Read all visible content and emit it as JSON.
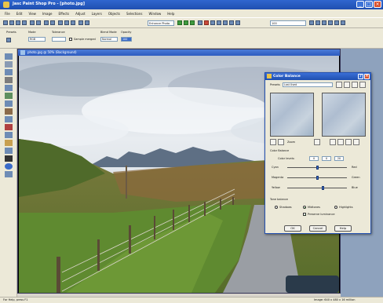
{
  "app": {
    "title": "Jasc Paint Shop Pro - [photo.jpg]",
    "menu": [
      "File",
      "Edit",
      "View",
      "Image",
      "Effects",
      "Adjust",
      "Layers",
      "Objects",
      "Selections",
      "Window",
      "Help"
    ]
  },
  "toolbar": {
    "dropdown_left": "Enhance Photo",
    "dropdown_right": "100"
  },
  "options": {
    "presets_label": "Presets",
    "mode_label": "Mode",
    "mode_value": "RGB",
    "tolerance_label": "Tolerance",
    "sample_label": "Sample merged",
    "blend_label": "Blend Mode",
    "blend_value": "Normal",
    "opacity_label": "Opacity",
    "opacity_value": "100"
  },
  "document": {
    "title": "photo.jpg @ 50% (Background)"
  },
  "dialog": {
    "title": "Color Balance",
    "presets_label": "Presets",
    "presets_value": "Last Used",
    "zoom_label": "Zoom",
    "color_levels_label": "Color levels:",
    "levels": [
      "0",
      "0",
      "20"
    ],
    "balance_group": "Color Balance",
    "sliders": [
      {
        "left": "Cyan",
        "right": "Red",
        "value": 0
      },
      {
        "left": "Magenta",
        "right": "Green",
        "value": 0
      },
      {
        "left": "Yellow",
        "right": "Blue",
        "value": 20
      }
    ],
    "tone_group": "Tone balance",
    "tones": [
      "Shadows",
      "Midtones",
      "Highlights"
    ],
    "tone_selected": "Midtones",
    "preserve_label": "Preserve luminance",
    "buttons": {
      "ok": "OK",
      "cancel": "Cancel",
      "help": "Help"
    }
  },
  "status": {
    "left": "For Help, press F1",
    "right": "Image: 640 x 480 x 16 million"
  },
  "colors": {
    "title_bar": "#2f66cf",
    "chrome": "#ece9d8",
    "accent": "#3a6bc8"
  }
}
